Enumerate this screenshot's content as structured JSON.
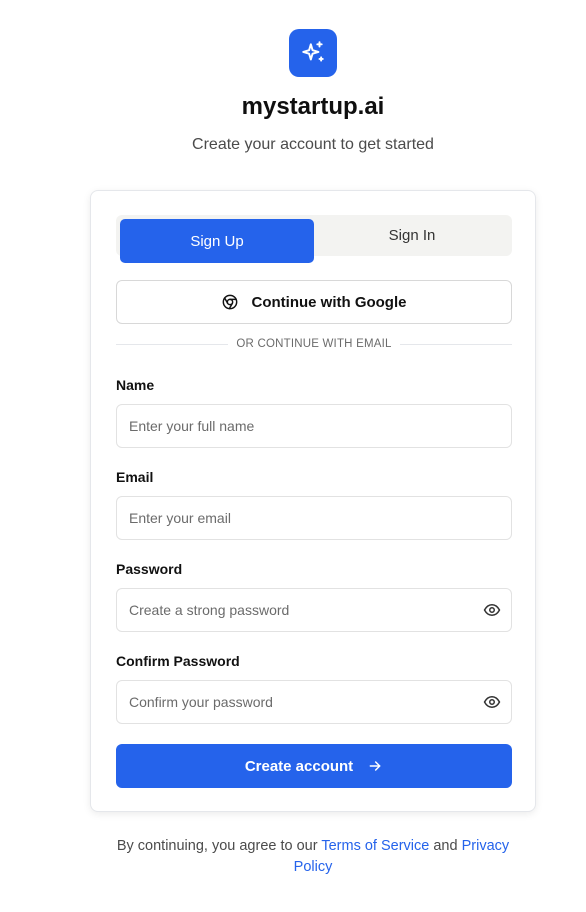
{
  "app": {
    "brand": "mystartup.ai",
    "subtitle": "Create your account to get started",
    "logo_icon": "sparkles-icon",
    "accent_color": "#2563eb"
  },
  "tabs": [
    {
      "label": "Sign Up",
      "active": true
    },
    {
      "label": "Sign In",
      "active": false
    }
  ],
  "google_button": {
    "label": "Continue with Google",
    "icon": "google-chrome-icon"
  },
  "divider_text": "OR CONTINUE WITH EMAIL",
  "form": {
    "name": {
      "label": "Name",
      "placeholder": "Enter your full name",
      "value": ""
    },
    "email": {
      "label": "Email",
      "placeholder": "Enter your email",
      "value": ""
    },
    "password": {
      "label": "Password",
      "placeholder": "Create a strong password",
      "value": "",
      "icon": "eye-icon"
    },
    "confirm_password": {
      "label": "Confirm Password",
      "placeholder": "Confirm your password",
      "value": "",
      "icon": "eye-icon"
    }
  },
  "submit": {
    "label": "Create account",
    "icon": "arrow-right-icon"
  },
  "footer": {
    "prefix": "By continuing, you agree to our",
    "terms_link": "Terms of Service",
    "and": "and",
    "privacy_link": "Privacy Policy"
  }
}
